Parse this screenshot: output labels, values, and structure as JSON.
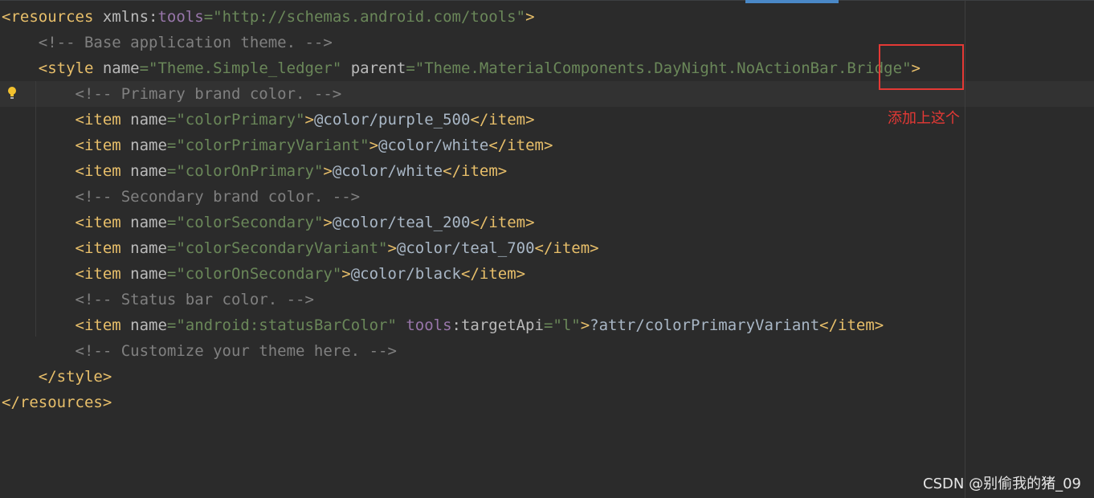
{
  "editor": {
    "language": "xml",
    "lines": [
      [
        {
          "t": "tag",
          "s": "<resources "
        },
        {
          "t": "attr",
          "s": "xmlns:"
        },
        {
          "t": "ns",
          "s": "tools"
        },
        {
          "t": "val",
          "s": "=\"http://schemas.android.com/tools\""
        },
        {
          "t": "tag",
          "s": ">"
        }
      ],
      [
        {
          "t": "txt",
          "s": "    "
        },
        {
          "t": "cmt",
          "s": "<!-- Base application theme. -->"
        }
      ],
      [
        {
          "t": "txt",
          "s": "    "
        },
        {
          "t": "tag",
          "s": "<style "
        },
        {
          "t": "attr",
          "s": "name"
        },
        {
          "t": "val",
          "s": "=\"Theme.Simple_ledger\" "
        },
        {
          "t": "attr",
          "s": "parent"
        },
        {
          "t": "val",
          "s": "=\"Theme.MaterialComponents.DayNight.NoActionBar.Bridge\""
        },
        {
          "t": "tag",
          "s": ">"
        }
      ],
      [
        {
          "t": "txt",
          "s": "        "
        },
        {
          "t": "cmt",
          "s": "<!-- Primary brand color. -->"
        }
      ],
      [
        {
          "t": "txt",
          "s": "        "
        },
        {
          "t": "tag",
          "s": "<item "
        },
        {
          "t": "attr",
          "s": "name"
        },
        {
          "t": "val",
          "s": "=\"colorPrimary\""
        },
        {
          "t": "tag",
          "s": ">"
        },
        {
          "t": "txt",
          "s": "@color/purple_500"
        },
        {
          "t": "tag",
          "s": "</item>"
        }
      ],
      [
        {
          "t": "txt",
          "s": "        "
        },
        {
          "t": "tag",
          "s": "<item "
        },
        {
          "t": "attr",
          "s": "name"
        },
        {
          "t": "val",
          "s": "=\"colorPrimaryVariant\""
        },
        {
          "t": "tag",
          "s": ">"
        },
        {
          "t": "txt",
          "s": "@color/white"
        },
        {
          "t": "tag",
          "s": "</item>"
        }
      ],
      [
        {
          "t": "txt",
          "s": "        "
        },
        {
          "t": "tag",
          "s": "<item "
        },
        {
          "t": "attr",
          "s": "name"
        },
        {
          "t": "val",
          "s": "=\"colorOnPrimary\""
        },
        {
          "t": "tag",
          "s": ">"
        },
        {
          "t": "txt",
          "s": "@color/white"
        },
        {
          "t": "tag",
          "s": "</item>"
        }
      ],
      [
        {
          "t": "txt",
          "s": "        "
        },
        {
          "t": "cmt",
          "s": "<!-- Secondary brand color. -->"
        }
      ],
      [
        {
          "t": "txt",
          "s": "        "
        },
        {
          "t": "tag",
          "s": "<item "
        },
        {
          "t": "attr",
          "s": "name"
        },
        {
          "t": "val",
          "s": "=\"colorSecondary\""
        },
        {
          "t": "tag",
          "s": ">"
        },
        {
          "t": "txt",
          "s": "@color/teal_200"
        },
        {
          "t": "tag",
          "s": "</item>"
        }
      ],
      [
        {
          "t": "txt",
          "s": "        "
        },
        {
          "t": "tag",
          "s": "<item "
        },
        {
          "t": "attr",
          "s": "name"
        },
        {
          "t": "val",
          "s": "=\"colorSecondaryVariant\""
        },
        {
          "t": "tag",
          "s": ">"
        },
        {
          "t": "txt",
          "s": "@color/teal_700"
        },
        {
          "t": "tag",
          "s": "</item>"
        }
      ],
      [
        {
          "t": "txt",
          "s": "        "
        },
        {
          "t": "tag",
          "s": "<item "
        },
        {
          "t": "attr",
          "s": "name"
        },
        {
          "t": "val",
          "s": "=\"colorOnSecondary\""
        },
        {
          "t": "tag",
          "s": ">"
        },
        {
          "t": "txt",
          "s": "@color/black"
        },
        {
          "t": "tag",
          "s": "</item>"
        }
      ],
      [
        {
          "t": "txt",
          "s": "        "
        },
        {
          "t": "cmt",
          "s": "<!-- Status bar color. -->"
        }
      ],
      [
        {
          "t": "txt",
          "s": "        "
        },
        {
          "t": "tag",
          "s": "<item "
        },
        {
          "t": "attr",
          "s": "name"
        },
        {
          "t": "val",
          "s": "=\"android:statusBarColor\" "
        },
        {
          "t": "ns",
          "s": "tools"
        },
        {
          "t": "attr",
          "s": ":targetApi"
        },
        {
          "t": "val",
          "s": "=\"l\""
        },
        {
          "t": "tag",
          "s": ">"
        },
        {
          "t": "txt",
          "s": "?attr/colorPrimaryVariant"
        },
        {
          "t": "tag",
          "s": "</item>"
        }
      ],
      [
        {
          "t": "txt",
          "s": "        "
        },
        {
          "t": "cmt",
          "s": "<!-- Customize your theme here. -->"
        }
      ],
      [
        {
          "t": "txt",
          "s": "    "
        },
        {
          "t": "tag",
          "s": "</style>"
        }
      ],
      [
        {
          "t": "tag",
          "s": "</resources>"
        }
      ]
    ]
  },
  "annotation": {
    "text": "添加上这个"
  },
  "watermark": {
    "text": "CSDN @别偷我的猪_09"
  },
  "icons": {
    "gutter": "lightbulb-icon"
  },
  "colors": {
    "background": "#2b2b2b",
    "tag": "#e8bf6a",
    "attribute": "#bababa",
    "namespace": "#9876aa",
    "value": "#6a8759",
    "comment": "#808080",
    "text": "#a9b7c6",
    "annotation": "#e53935"
  }
}
